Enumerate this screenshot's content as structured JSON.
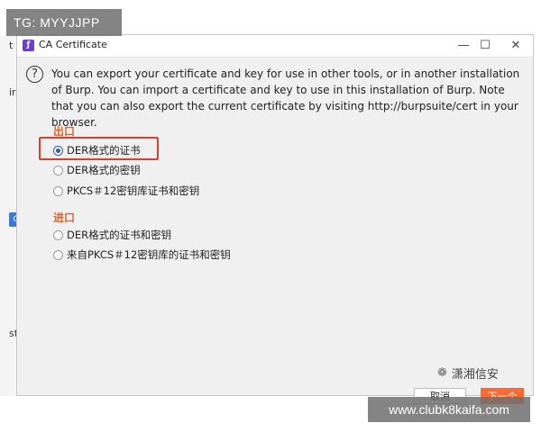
{
  "watermark_top": "TG: MYYJJPP",
  "watermark_bottom": "www.clubk8kaifa.com",
  "background": {
    "fragments": [
      "t",
      "ir",
      "st"
    ],
    "badge": "G"
  },
  "dialog": {
    "title": "CA Certificate",
    "window_buttons": {
      "minimize": "—",
      "maximize": "☐",
      "close": "✕"
    },
    "description": "You can export your certificate and key for use in other tools, or in another installation of Burp. You can import a certificate and key to use in this installation of Burp. Note that you can also export the current certificate by visiting http://burpsuite/cert in your browser.",
    "export_label": "出口",
    "export_options": [
      {
        "label": "DER格式的证书",
        "checked": true
      },
      {
        "label": "DER格式的密钥",
        "checked": false
      },
      {
        "label": "PKCS＃12密钥库证书和密钥",
        "checked": false
      }
    ],
    "import_label": "进口",
    "import_options": [
      {
        "label": "DER格式的证书和密钥",
        "checked": false
      },
      {
        "label": "来自PKCS＃12密钥库的证书和密钥",
        "checked": false
      }
    ],
    "brand": "潇湘信安",
    "cancel_label": "取消",
    "next_label": "下一个"
  },
  "colors": {
    "accent_orange": "#ff6a33",
    "section_label": "#e0622a",
    "highlight_box": "#d9412d",
    "radio_checked": "#2a5da8"
  }
}
